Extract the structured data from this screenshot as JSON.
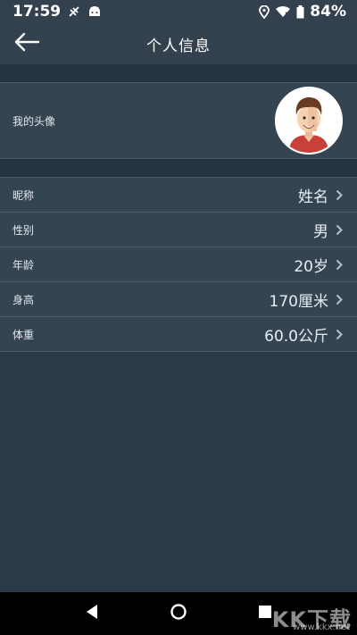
{
  "status_bar": {
    "time": "17:59",
    "battery": "84%"
  },
  "app_bar": {
    "title": "个人信息"
  },
  "avatar_row": {
    "label": "我的头像"
  },
  "items": [
    {
      "label": "昵称",
      "value": "姓名"
    },
    {
      "label": "性别",
      "value": "男"
    },
    {
      "label": "年龄",
      "value": "20岁"
    },
    {
      "label": "身高",
      "value": "170厘米"
    },
    {
      "label": "体重",
      "value": "60.0公斤"
    }
  ],
  "watermark": {
    "logo": "KK下载",
    "url": "www.kkx.net"
  },
  "icons": {
    "back": "arrow-left-icon",
    "chevron": "chevron-right-icon",
    "nav": [
      "back-triangle-icon",
      "home-circle-icon",
      "recents-square-icon"
    ]
  },
  "colors": {
    "background": "#2b3a49",
    "row": "#344451",
    "bar": "#33414e"
  }
}
